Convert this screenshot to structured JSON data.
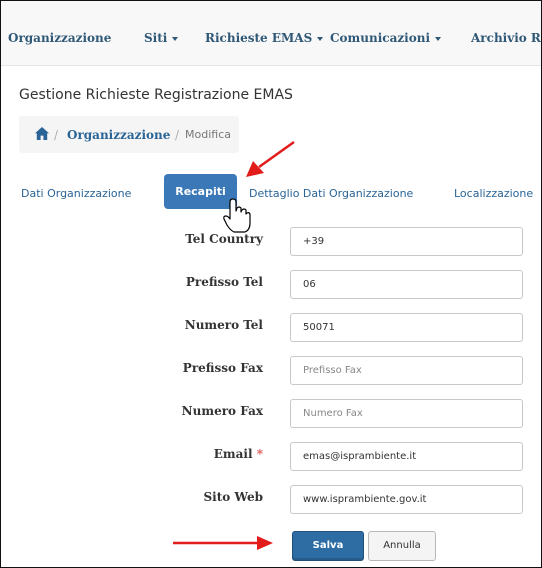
{
  "nav": {
    "organizzazione": "Organizzazione",
    "siti": "Siti",
    "richieste_emas": "Richieste EMAS",
    "comunicazioni": "Comunicazioni",
    "archivio": "Archivio Re"
  },
  "page": {
    "title": "Gestione Richieste Registrazione EMAS"
  },
  "breadcrumb": {
    "home_icon": "home-icon",
    "separator": "/",
    "organizzazione": "Organizzazione",
    "modifica": "Modifica"
  },
  "tabs": {
    "dati_organizzazione": "Dati Organizzazione",
    "recapiti": "Recapiti",
    "dettaglio": "Dettaglio Dati Organizzazione",
    "localizzazione": "Localizzazione"
  },
  "form": {
    "tel_country": {
      "label": "Tel Country",
      "value": "+39",
      "placeholder": ""
    },
    "prefisso_tel": {
      "label": "Prefisso Tel",
      "value": "06",
      "placeholder": ""
    },
    "numero_tel": {
      "label": "Numero Tel",
      "value": "50071",
      "placeholder": ""
    },
    "prefisso_fax": {
      "label": "Prefisso Fax",
      "value": "",
      "placeholder": "Prefisso Fax"
    },
    "numero_fax": {
      "label": "Numero Fax",
      "value": "",
      "placeholder": "Numero Fax"
    },
    "email": {
      "label": "Email",
      "required_mark": "*",
      "value": "emas@isprambiente.it",
      "placeholder": ""
    },
    "sito_web": {
      "label": "Sito Web",
      "value": "www.isprambiente.gov.it",
      "placeholder": ""
    }
  },
  "buttons": {
    "save": "Salva",
    "cancel": "Annulla"
  },
  "colors": {
    "primary": "#2e6da4",
    "link": "#2a6496",
    "annotation_arrow": "#e21b1b",
    "required": "#d9534f"
  }
}
